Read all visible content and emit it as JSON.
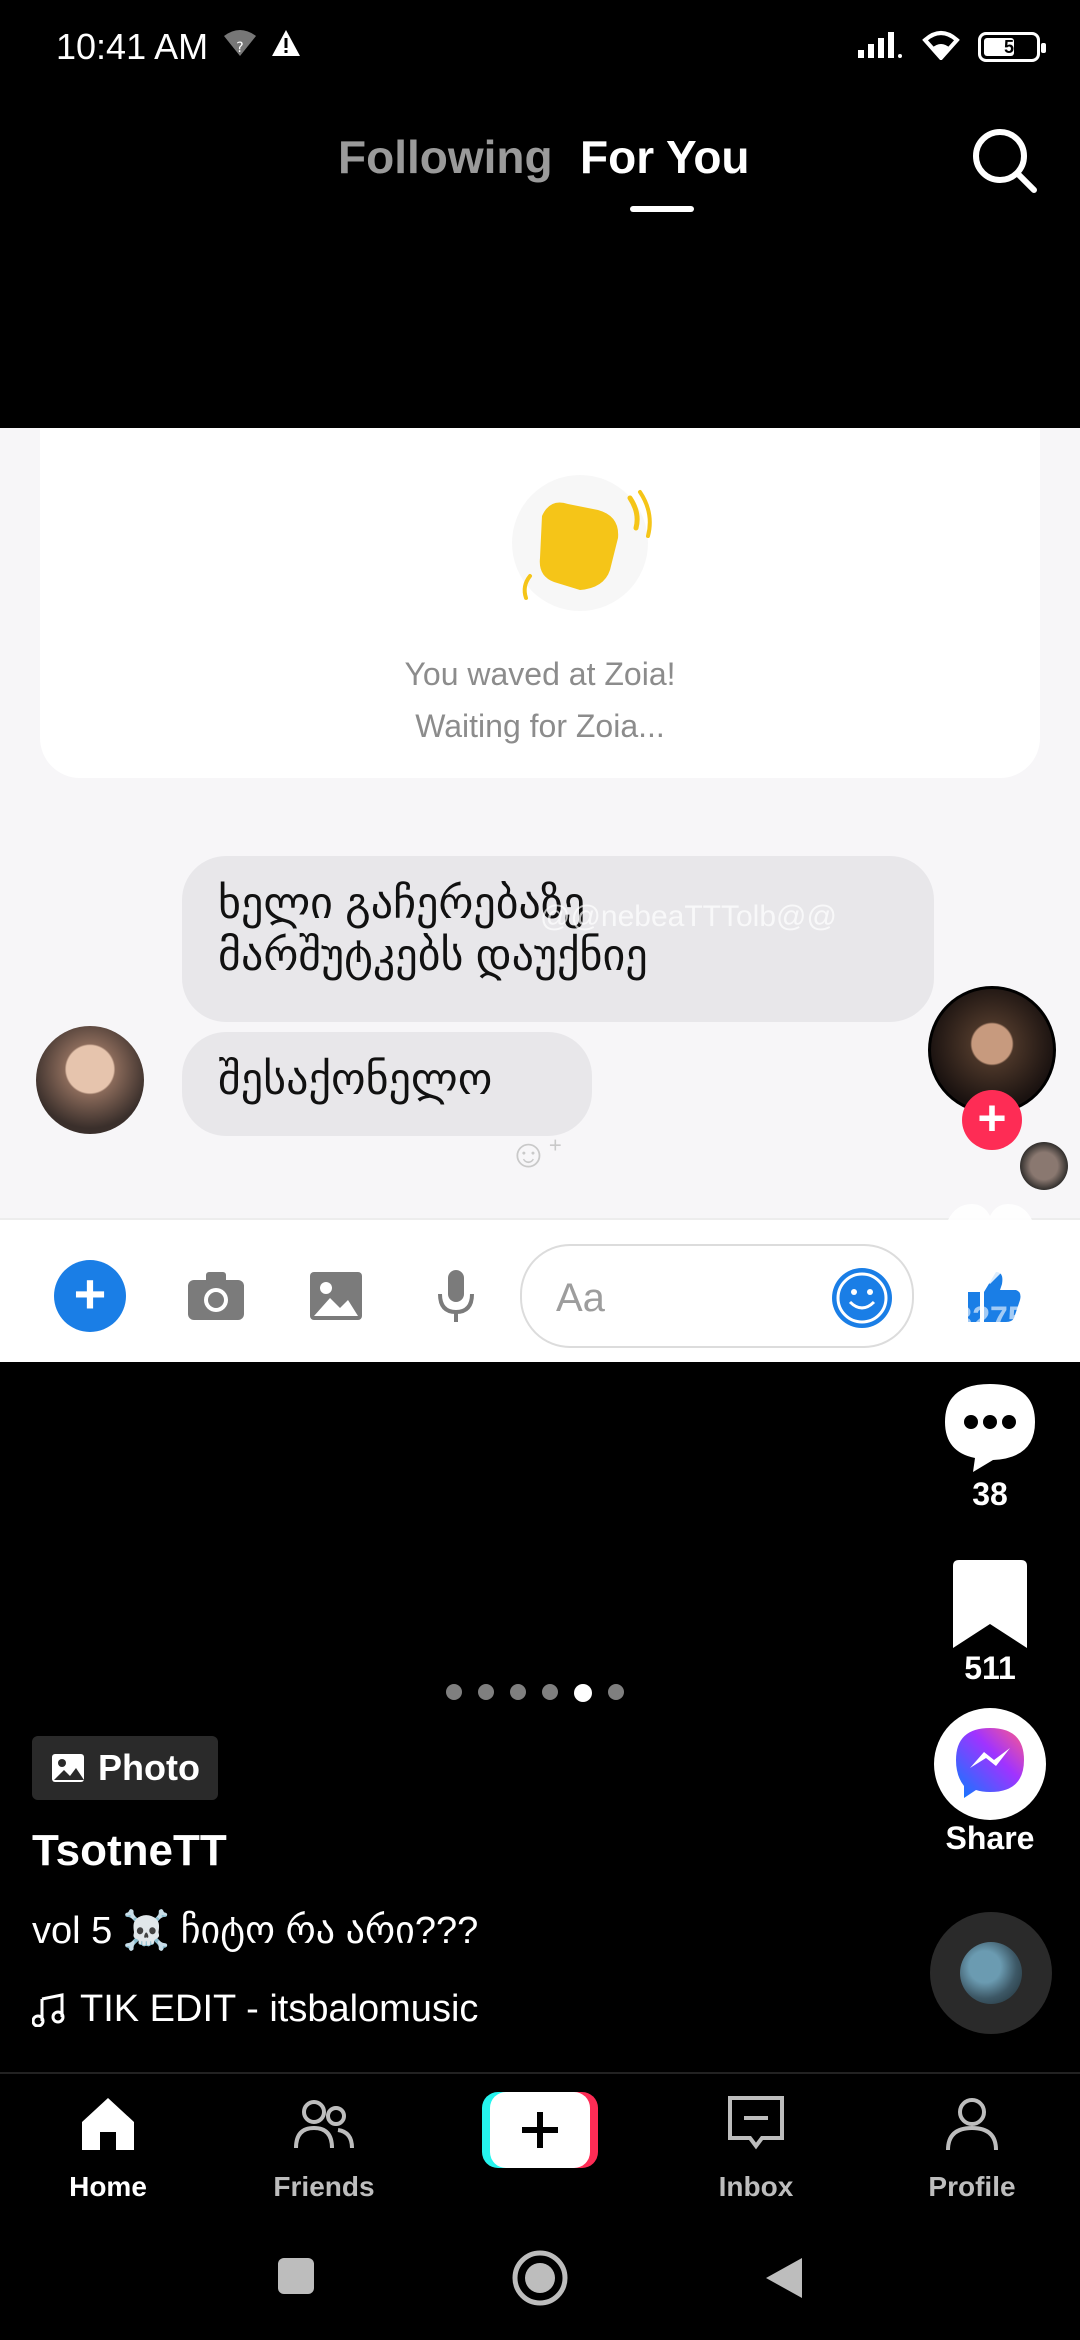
{
  "status_bar": {
    "time": "10:41 AM",
    "battery": "5"
  },
  "top_nav": {
    "following": "Following",
    "for_you": "For You"
  },
  "post_image": {
    "wave_line1": "You waved at Zoia!",
    "wave_line2": "Waiting for Zoia...",
    "bubble1_line1": "ხელი გაჩერებაზე",
    "bubble1_line2": "მარშუტკებს დაუქნიე",
    "bubble2": "შესაქონელო",
    "input_placeholder": "Aa",
    "watermark": "@@nebeaTTTolb@@"
  },
  "rail": {
    "likes": "3275",
    "comments": "38",
    "saves": "511",
    "share_label": "Share"
  },
  "carousel": {
    "count": 6,
    "active": 5
  },
  "info": {
    "badge": "Photo",
    "author": "TsotneTT",
    "caption": "vol 5 ☠️ ჩიტო რა არი???",
    "song": "TIK EDIT - itsbalomusic"
  },
  "bottom_nav": {
    "home": "Home",
    "friends": "Friends",
    "inbox": "Inbox",
    "profile": "Profile"
  }
}
